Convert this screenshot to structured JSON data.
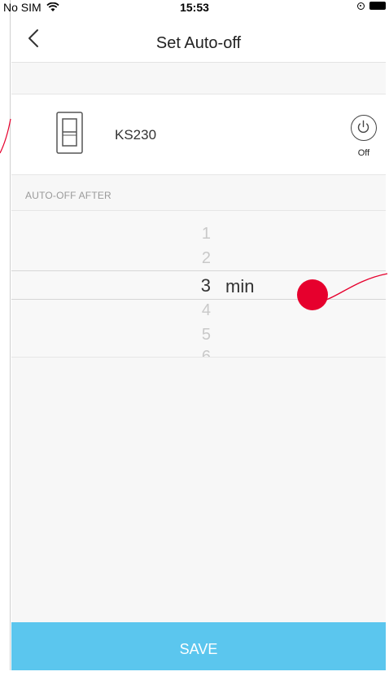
{
  "status_bar": {
    "carrier": "No SIM",
    "time": "15:53"
  },
  "nav": {
    "title": "Set Auto-off"
  },
  "device": {
    "name": "KS230",
    "power_label": "Off"
  },
  "section": {
    "title": "AUTO-OFF AFTER"
  },
  "picker": {
    "values": [
      "1",
      "2",
      "3",
      "4",
      "5",
      "6"
    ],
    "selected": "3",
    "unit": "min"
  },
  "footer": {
    "save_label": "SAVE"
  },
  "colors": {
    "accent": "#5bc6ee",
    "annotation": "#e6002d"
  }
}
